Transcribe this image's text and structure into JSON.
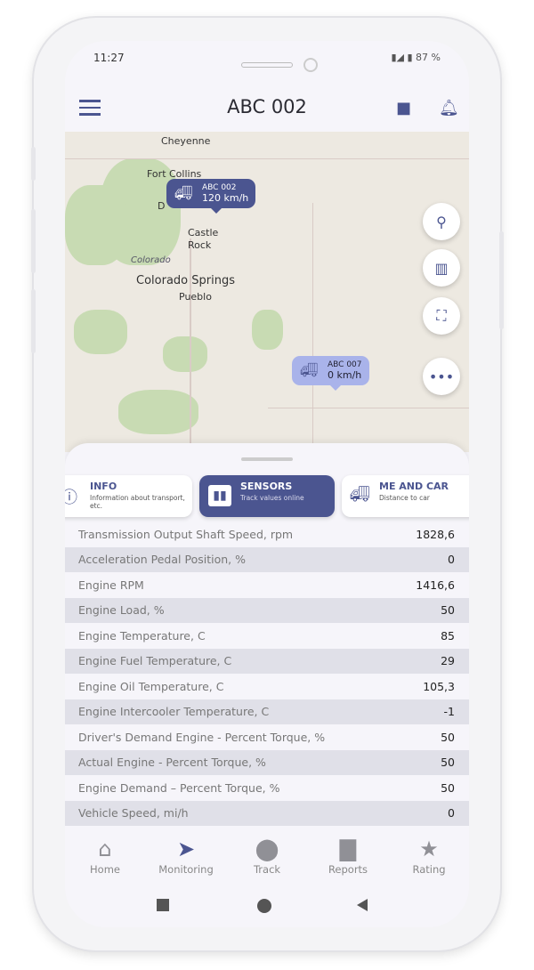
{
  "status": {
    "time": "11:27",
    "battery": "87 %"
  },
  "header": {
    "title": "ABC 002",
    "menu_icon": "hamburger-icon",
    "folder_icon": "folder-icon",
    "bell_icon": "bell-icon"
  },
  "map": {
    "cities": [
      "Cheyenne",
      "Fort Collins",
      "D",
      "Castle",
      "Rock",
      "Colorado",
      "Colorado Springs",
      "Pueblo"
    ],
    "vehicles": [
      {
        "name": "ABC 002",
        "speed": "120 km/h",
        "color": "#4b5590"
      },
      {
        "name": "ABC 007",
        "speed": "0 km/h",
        "color": "#a9b3ea"
      }
    ],
    "fabs": [
      "search-icon",
      "map-icon",
      "focus-icon",
      "more-icon"
    ]
  },
  "tabs": [
    {
      "label": "INFO",
      "sub": "Information about transport, etc."
    },
    {
      "label": "SENSORS",
      "sub": "Track values online",
      "active": true
    },
    {
      "label": "ME AND CAR",
      "sub": "Distance to car"
    }
  ],
  "sensors": [
    {
      "name": "Transmission Output Shaft Speed, rpm",
      "value": "1828,6"
    },
    {
      "name": "Acceleration Pedal Position, %",
      "value": "0"
    },
    {
      "name": "Engine RPM",
      "value": "1416,6"
    },
    {
      "name": "Engine Load, %",
      "value": "50"
    },
    {
      "name": "Engine Temperature, C",
      "value": "85"
    },
    {
      "name": "Engine Fuel Temperature, C",
      "value": "29"
    },
    {
      "name": "Engine Oil Temperature, C",
      "value": "105,3"
    },
    {
      "name": "Engine Intercooler Temperature, C",
      "value": "-1"
    },
    {
      "name": "Driver's Demand Engine - Percent Torque, %",
      "value": "50"
    },
    {
      "name": "Actual Engine - Percent Torque, %",
      "value": "50"
    },
    {
      "name": "Engine Demand – Percent Torque, %",
      "value": "50"
    },
    {
      "name": "Vehicle Speed, mi/h",
      "value": "0"
    }
  ],
  "nav": [
    {
      "label": "Home"
    },
    {
      "label": "Monitoring",
      "active": true
    },
    {
      "label": "Track"
    },
    {
      "label": "Reports"
    },
    {
      "label": "Rating"
    }
  ],
  "colors": {
    "accent": "#4b5590"
  }
}
